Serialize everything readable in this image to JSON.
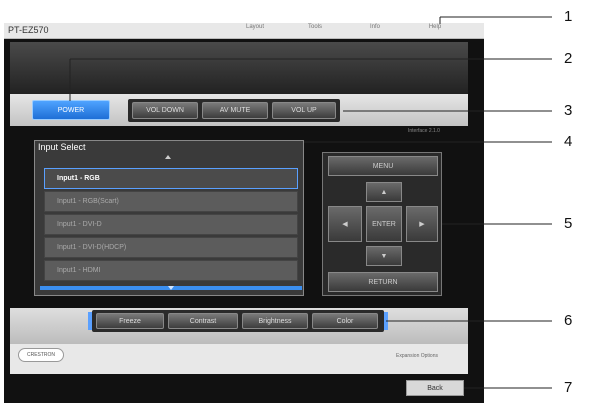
{
  "header": {
    "model": "PT-EZ570",
    "nav": [
      "Layout",
      "Tools",
      "Info",
      "Help"
    ]
  },
  "control_bar": {
    "power": "POWER",
    "vol_down": "VOL DOWN",
    "av_mute": "AV MUTE",
    "vol_up": "VOL UP"
  },
  "version": "Interface 2.1.0",
  "input_select": {
    "title": "Input Select",
    "items": [
      "Input1 - RGB",
      "Input1 - RGB(Scart)",
      "Input1 - DVI-D",
      "Input1 - DVI-D(HDCP)",
      "Input1 - HDMI"
    ]
  },
  "nav_pad": {
    "menu": "MENU",
    "up": "▲",
    "left": "◀",
    "enter": "ENTER",
    "right": "▶",
    "down": "▼",
    "return": "RETURN"
  },
  "functions": {
    "freeze": "Freeze",
    "contrast": "Contrast",
    "brightness": "Brightness",
    "color": "Color"
  },
  "footer": {
    "logo": "CRESTRON",
    "expansion": "Expansion Options",
    "back": "Back"
  },
  "callouts": [
    "1",
    "2",
    "3",
    "4",
    "5",
    "6",
    "7"
  ]
}
